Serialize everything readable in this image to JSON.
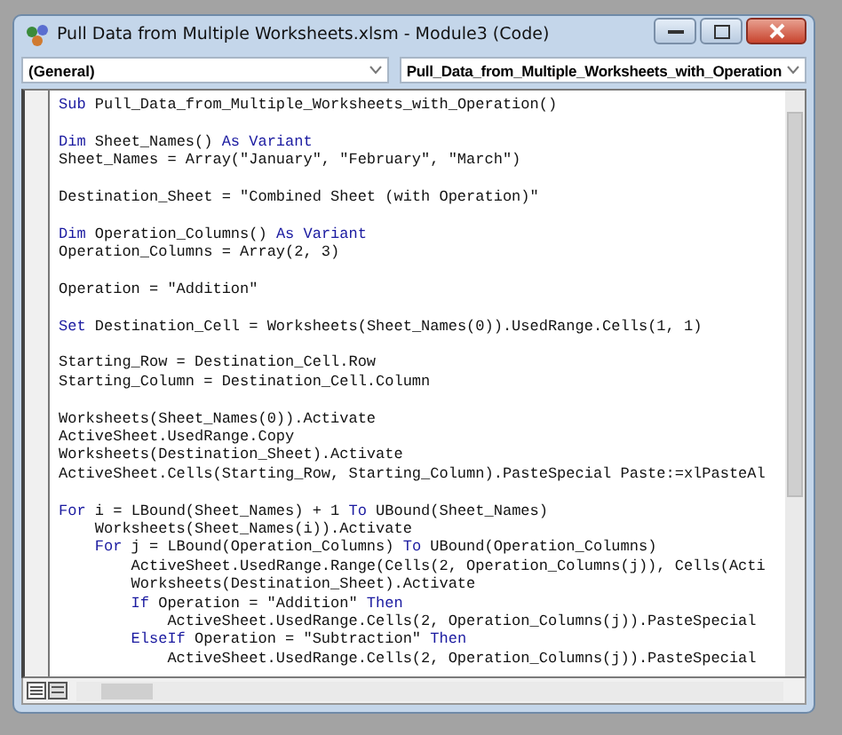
{
  "window": {
    "title": "Pull Data from Multiple Worksheets.xlsm - Module3 (Code)"
  },
  "object_dropdown": {
    "value": "(General)"
  },
  "procedure_dropdown": {
    "value": "Pull_Data_from_Multiple_Worksheets_with_Operation"
  },
  "code_lines": [
    {
      "kind": "code",
      "segments": [
        {
          "text": "Sub",
          "kind": "keyword"
        },
        {
          "text": " Pull_Data_from_Multiple_Worksheets_with_Operation()",
          "kind": "code"
        }
      ]
    },
    {
      "kind": "blank"
    },
    {
      "kind": "code",
      "segments": [
        {
          "text": "Dim",
          "kind": "keyword"
        },
        {
          "text": " Sheet_Names() ",
          "kind": "code"
        },
        {
          "text": "As Variant",
          "kind": "keyword"
        }
      ]
    },
    {
      "kind": "code",
      "segments": [
        {
          "text": "Sheet_Names = Array(\"January\", \"February\", \"March\")",
          "kind": "code"
        }
      ]
    },
    {
      "kind": "blank"
    },
    {
      "kind": "code",
      "segments": [
        {
          "text": "Destination_Sheet = \"Combined Sheet (with Operation)\"",
          "kind": "code"
        }
      ]
    },
    {
      "kind": "blank"
    },
    {
      "kind": "code",
      "segments": [
        {
          "text": "Dim",
          "kind": "keyword"
        },
        {
          "text": " Operation_Columns() ",
          "kind": "code"
        },
        {
          "text": "As Variant",
          "kind": "keyword"
        }
      ]
    },
    {
      "kind": "code",
      "segments": [
        {
          "text": "Operation_Columns = Array(2, 3)",
          "kind": "code"
        }
      ]
    },
    {
      "kind": "blank"
    },
    {
      "kind": "code",
      "segments": [
        {
          "text": "Operation = \"Addition\"",
          "kind": "code"
        }
      ]
    },
    {
      "kind": "blank"
    },
    {
      "kind": "code",
      "segments": [
        {
          "text": "Set",
          "kind": "keyword"
        },
        {
          "text": " Destination_Cell = Worksheets(Sheet_Names(0)).UsedRange.Cells(1, 1)",
          "kind": "code"
        }
      ]
    },
    {
      "kind": "blank"
    },
    {
      "kind": "code",
      "segments": [
        {
          "text": "Starting_Row = Destination_Cell.Row",
          "kind": "code"
        }
      ]
    },
    {
      "kind": "code",
      "segments": [
        {
          "text": "Starting_Column = Destination_Cell.Column",
          "kind": "code"
        }
      ]
    },
    {
      "kind": "blank"
    },
    {
      "kind": "code",
      "segments": [
        {
          "text": "Worksheets(Sheet_Names(0)).Activate",
          "kind": "code"
        }
      ]
    },
    {
      "kind": "code",
      "segments": [
        {
          "text": "ActiveSheet.UsedRange.Copy",
          "kind": "code"
        }
      ]
    },
    {
      "kind": "code",
      "segments": [
        {
          "text": "Worksheets(Destination_Sheet).Activate",
          "kind": "code"
        }
      ]
    },
    {
      "kind": "code",
      "segments": [
        {
          "text": "ActiveSheet.Cells(Starting_Row, Starting_Column).PasteSpecial Paste:=xlPasteAl",
          "kind": "code"
        }
      ]
    },
    {
      "kind": "blank"
    },
    {
      "kind": "code",
      "segments": [
        {
          "text": "For",
          "kind": "keyword"
        },
        {
          "text": " i = LBound(Sheet_Names) + 1 ",
          "kind": "code"
        },
        {
          "text": "To",
          "kind": "keyword"
        },
        {
          "text": " UBound(Sheet_Names)",
          "kind": "code"
        }
      ],
      "children": [
        {
          "kind": "code",
          "segments": [
            {
              "text": "Worksheets(Sheet_Names(i)).Activate",
              "kind": "code"
            }
          ]
        },
        {
          "kind": "code",
          "segments": [
            {
              "text": "For",
              "kind": "keyword"
            },
            {
              "text": " j = LBound(Operation_Columns) ",
              "kind": "code"
            },
            {
              "text": "To",
              "kind": "keyword"
            },
            {
              "text": " UBound(Operation_Columns)",
              "kind": "code"
            }
          ],
          "children": [
            {
              "kind": "code",
              "segments": [
                {
                  "text": "ActiveSheet.UsedRange.Range(Cells(2, Operation_Columns(j)), Cells(Acti",
                  "kind": "code"
                }
              ]
            },
            {
              "kind": "code",
              "segments": [
                {
                  "text": "Worksheets(Destination_Sheet).Activate",
                  "kind": "code"
                }
              ]
            },
            {
              "kind": "code",
              "segments": [
                {
                  "text": "If",
                  "kind": "keyword"
                },
                {
                  "text": " Operation = \"Addition\" ",
                  "kind": "code"
                },
                {
                  "text": "Then",
                  "kind": "keyword"
                }
              ],
              "children": [
                {
                  "kind": "code",
                  "segments": [
                    {
                      "text": "ActiveSheet.UsedRange.Cells(2, Operation_Columns(j)).PasteSpecial",
                      "kind": "code"
                    }
                  ]
                }
              ]
            },
            {
              "kind": "code",
              "segments": [
                {
                  "text": "ElseIf",
                  "kind": "keyword"
                },
                {
                  "text": " Operation = \"Subtraction\" ",
                  "kind": "code"
                },
                {
                  "text": "Then",
                  "kind": "keyword"
                }
              ],
              "children": [
                {
                  "kind": "code",
                  "segments": [
                    {
                      "text": "ActiveSheet.UsedRange.Cells(2, Operation_Columns(j)).PasteSpecial",
                      "kind": "code"
                    }
                  ]
                }
              ]
            }
          ]
        }
      ]
    }
  ]
}
